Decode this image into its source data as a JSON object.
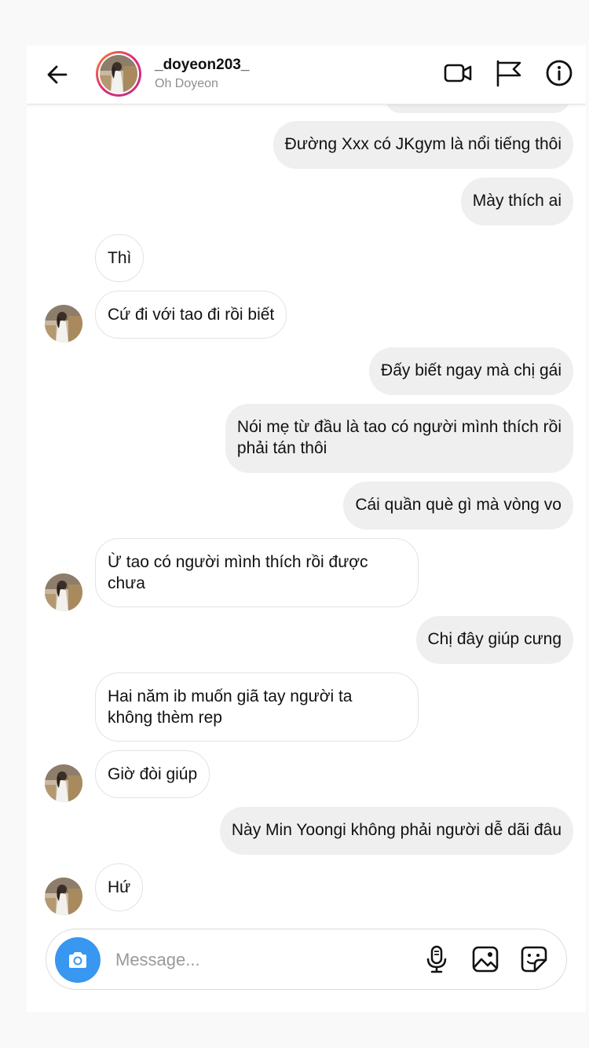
{
  "header": {
    "username": "_doyeon203_",
    "fullname": "Oh Doyeon",
    "icons": [
      "back-arrow-icon",
      "video-call-icon",
      "flag-icon",
      "info-icon"
    ]
  },
  "messages": [
    {
      "side": "out",
      "text": "Đường Xxx có JKgym là nổi tiếng thôi"
    },
    {
      "side": "out",
      "text": "Mày thích ai"
    },
    {
      "side": "in",
      "text": "Thì"
    },
    {
      "side": "in",
      "text": "Cứ đi với tao đi rồi biết"
    },
    {
      "side": "out",
      "text": "Đấy biết ngay mà chị gái"
    },
    {
      "side": "out",
      "lines": [
        "Nói mẹ từ đầu là tao có người mình thích rồi",
        "phải tán thôi"
      ]
    },
    {
      "side": "out",
      "text": "Cái quần què gì mà vòng vo"
    },
    {
      "side": "in",
      "lines": [
        "Ừ tao có người mình thích rồi được",
        "chưa"
      ]
    },
    {
      "side": "out",
      "text": "Chị đây giúp cưng"
    },
    {
      "side": "in",
      "lines": [
        "Hai năm ib muốn giã tay người ta",
        "không thèm rep"
      ]
    },
    {
      "side": "in",
      "text": "Giờ đòi giúp"
    },
    {
      "side": "out",
      "text": "Này Min Yoongi không phải người dễ dãi đâu"
    },
    {
      "side": "in",
      "text": "Hứ"
    }
  ],
  "composer": {
    "placeholder": "Message...",
    "icons": [
      "camera-icon",
      "microphone-icon",
      "gallery-icon",
      "sticker-icon"
    ]
  },
  "colors": {
    "accent": "#3897f0",
    "outgoing_bubble": "#efefef",
    "incoming_border": "#e3e3e3",
    "story_ring": "#dd2a7b"
  }
}
